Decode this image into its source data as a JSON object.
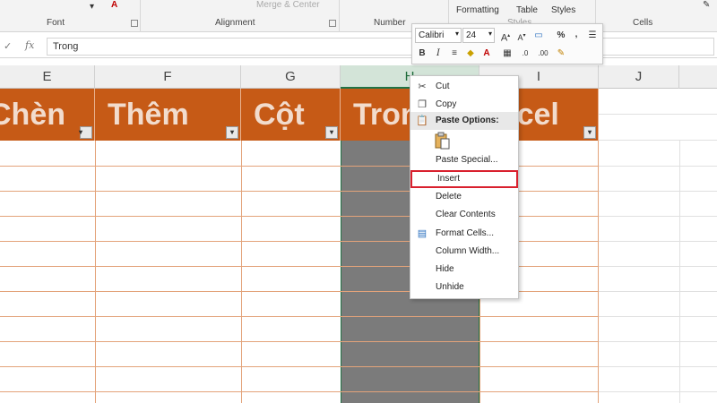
{
  "ribbon": {
    "groups": [
      "Font",
      "Alignment",
      "Number",
      "Styles",
      "Cells"
    ],
    "merge_center": "Merge & Center",
    "formatting": "Formatting",
    "table": "Table",
    "styles_btn": "Styles"
  },
  "formula_bar": {
    "cancel_glyph": "✓",
    "fx": "fx",
    "value": "Trong"
  },
  "columns": [
    "E",
    "F",
    "G",
    "H",
    "I",
    "J"
  ],
  "header_row": [
    "Chèn",
    "Thêm",
    "Cột",
    "Trong",
    "Excel"
  ],
  "mini_toolbar": {
    "font_name": "Calibri",
    "font_size": "24"
  },
  "context_menu": {
    "cut": "Cut",
    "copy": "Copy",
    "paste_options": "Paste Options:",
    "paste_special": "Paste Special...",
    "insert": "Insert",
    "delete": "Delete",
    "clear_contents": "Clear Contents",
    "format_cells": "Format Cells...",
    "column_width": "Column Width...",
    "hide": "Hide",
    "unhide": "Unhide"
  },
  "colors": {
    "header_fill": "#c65a16",
    "selected_column": "#7b7b7b",
    "highlight_border": "#d9202e"
  }
}
